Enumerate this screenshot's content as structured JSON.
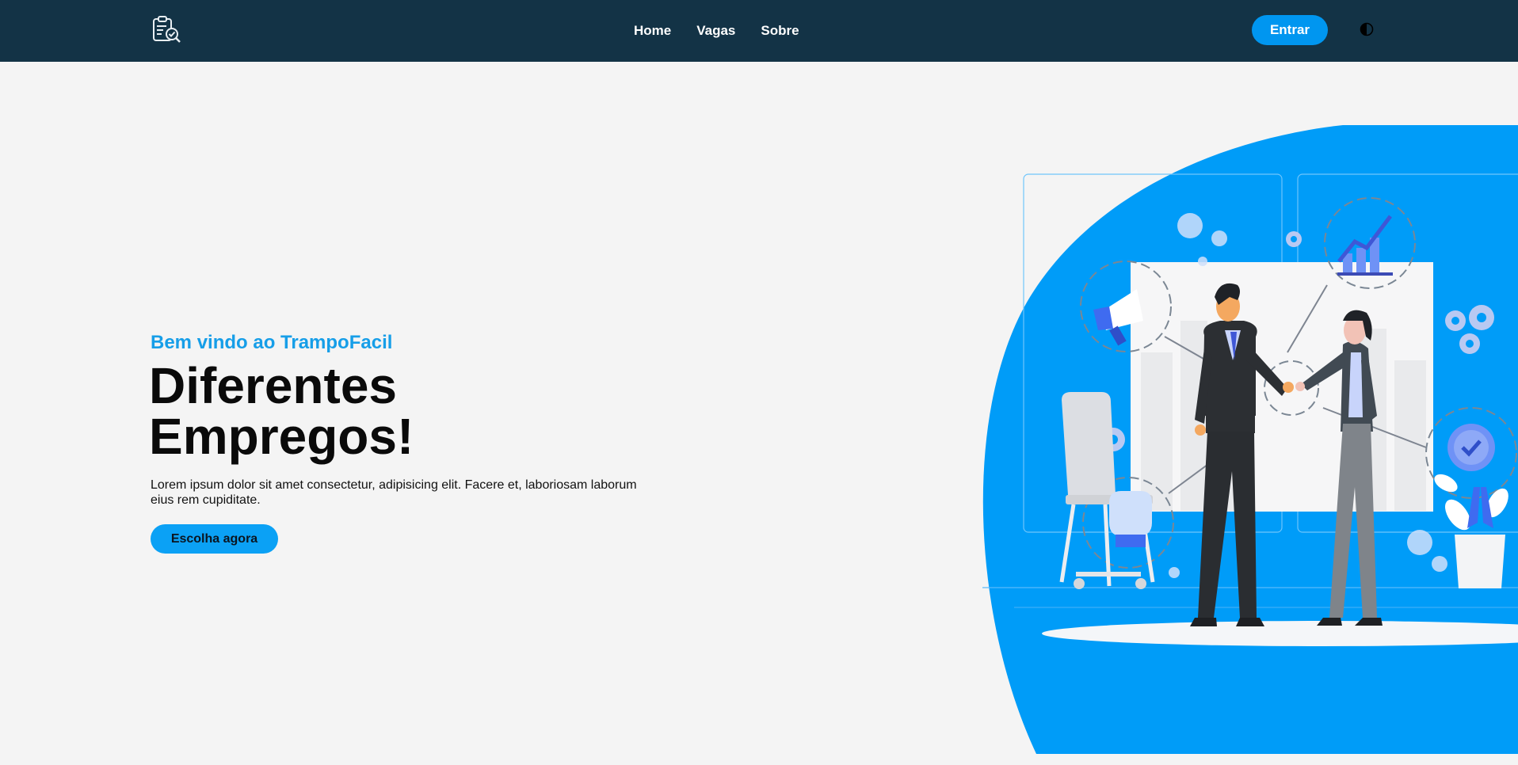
{
  "header": {
    "nav": [
      "Home",
      "Vagas",
      "Sobre"
    ],
    "login_label": "Entrar",
    "logo_icon": "clipboard-search-icon",
    "theme_icon": "contrast-icon"
  },
  "hero": {
    "subtitle": "Bem vindo ao TrampoFacil",
    "title_line1": "Diferentes",
    "title_line2": "Empregos!",
    "description": "Lorem ipsum dolor sit amet consectetur, adipisicing elit. Facere et, laboriosam laborum eius rem cupiditate.",
    "cta_label": "Escolha agora"
  },
  "colors": {
    "header_bg": "#133346",
    "accent": "#0096f0",
    "page_bg": "#f4f4f4",
    "subtitle": "#169ee8"
  }
}
